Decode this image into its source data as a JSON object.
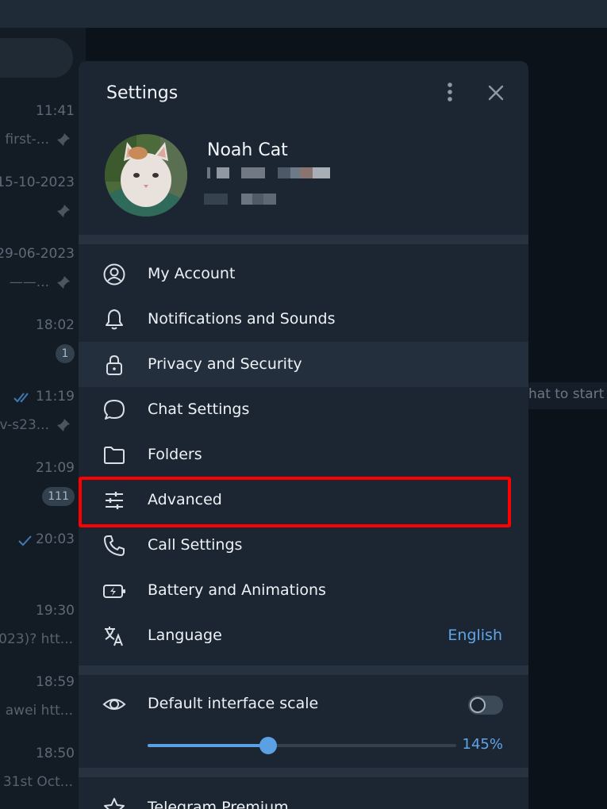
{
  "chat_list": {
    "rows": [
      {
        "time": "11:41",
        "snippet": "first-...",
        "pinned": true
      },
      {
        "time": "15-10-2023",
        "snippet": "",
        "pinned": true
      },
      {
        "time": "29-06-2023",
        "snippet": "——...",
        "pinned": true
      },
      {
        "time": "18:02",
        "snippet": "",
        "badge": "1"
      },
      {
        "time": "11:19",
        "snippet": "v-s23...",
        "pinned": true,
        "read_status": "double-check"
      },
      {
        "time": "21:09",
        "snippet": "",
        "badge": "111"
      },
      {
        "time": "20:03",
        "snippet": "",
        "read_status": "single-check"
      },
      {
        "time": "19:30",
        "snippet": "023)? htt..."
      },
      {
        "time": "18:59",
        "snippet": "awei  htt..."
      },
      {
        "time": "18:50",
        "snippet": "31st Oct..."
      }
    ]
  },
  "right_pane": {
    "hint": "hat to start"
  },
  "settings": {
    "title": "Settings",
    "profile": {
      "name": "Noah Cat"
    },
    "menu_items": [
      {
        "label": "My Account",
        "icon": "account-icon"
      },
      {
        "label": "Notifications and Sounds",
        "icon": "bell-icon"
      },
      {
        "label": "Privacy and Security",
        "icon": "lock-icon"
      },
      {
        "label": "Chat Settings",
        "icon": "chat-bubble-icon"
      },
      {
        "label": "Folders",
        "icon": "folder-icon"
      },
      {
        "label": "Advanced",
        "icon": "sliders-icon"
      },
      {
        "label": "Call Settings",
        "icon": "phone-icon"
      },
      {
        "label": "Battery and Animations",
        "icon": "battery-icon"
      },
      {
        "label": "Language",
        "icon": "translate-icon",
        "value": "English"
      }
    ],
    "scale": {
      "label": "Default interface scale",
      "toggle_on": false,
      "value_text": "145%",
      "slider_fraction": 0.39
    },
    "premium": {
      "label": "Telegram Premium"
    }
  },
  "colors": {
    "accent": "#5fa5e8",
    "highlight_box": "#ff0000",
    "panel": "#1b2632"
  }
}
